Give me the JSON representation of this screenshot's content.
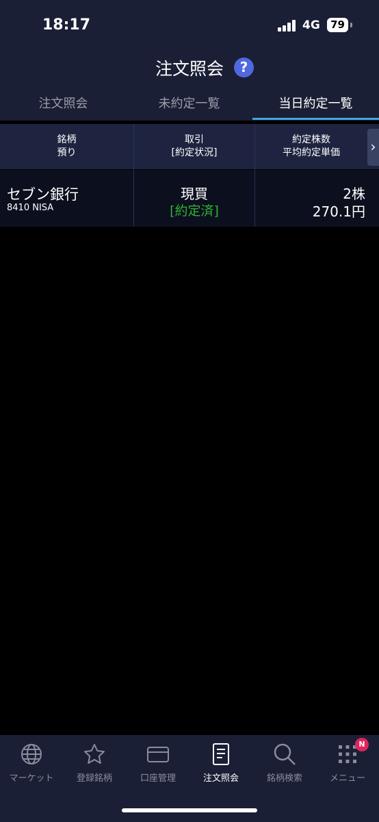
{
  "status_bar": {
    "time": "18:17",
    "network": "4G",
    "battery": "79"
  },
  "header": {
    "title": "注文照会",
    "help": "?"
  },
  "tabs": [
    {
      "label": "注文照会",
      "active": false
    },
    {
      "label": "未約定一覧",
      "active": false
    },
    {
      "label": "当日約定一覧",
      "active": true
    }
  ],
  "table": {
    "headers": [
      [
        "銘柄",
        "預り"
      ],
      [
        "取引",
        "[約定状況]"
      ],
      [
        "約定株数",
        "平均約定単価"
      ]
    ],
    "rows": [
      {
        "name": "セブン銀行",
        "code": "8410 NISA",
        "trade": "現買",
        "status": "[約定済]",
        "quantity": "2株",
        "price": "270.1円"
      }
    ]
  },
  "bottom_nav": [
    {
      "label": "マーケット",
      "icon": "globe-icon"
    },
    {
      "label": "登録銘柄",
      "icon": "star-icon"
    },
    {
      "label": "口座管理",
      "icon": "card-icon"
    },
    {
      "label": "注文照会",
      "icon": "document-icon",
      "active": true
    },
    {
      "label": "銘柄検索",
      "icon": "search-icon"
    },
    {
      "label": "メニュー",
      "icon": "grid-menu-icon"
    }
  ],
  "menu_badge": "N",
  "colors": {
    "nav_bg": "#1b1f35",
    "accent": "#3aa8e8",
    "filled_green": "#2fb431",
    "badge": "#e0245e"
  }
}
